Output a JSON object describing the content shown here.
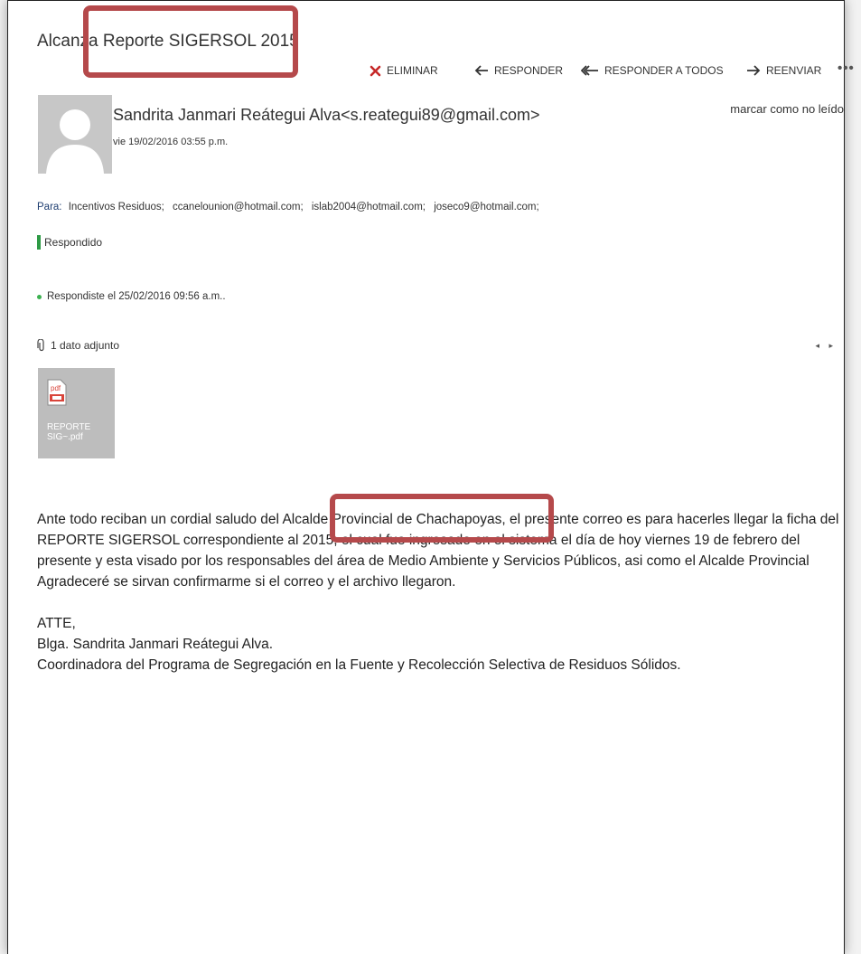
{
  "email": {
    "subject": "Alcanza Reporte SIGERSOL 2015",
    "toolbar": {
      "delete_label": "ELIMINAR",
      "reply_label": "RESPONDER",
      "reply_all_label": "RESPONDER A TODOS",
      "forward_label": "REENVIAR",
      "more_label": "•••"
    },
    "mark_unread": "marcar como no leído",
    "sender": "Sandrita Janmari Reátegui Alva<s.reategui89@gmail.com>",
    "date": "vie 19/02/2016 03:55 p.m.",
    "to_label": "Para:",
    "recipients": [
      "Incentivos Residuos;",
      "ccanelounion@hotmail.com;",
      "islab2004@hotmail.com;",
      "joseco9@hotmail.com;"
    ],
    "status": "Respondido",
    "replied_note": "Respondiste el 25/02/2016 09:56 a.m..",
    "attachment_count": "1 dato adjunto",
    "attachment_nav": "◂ ▸",
    "attachment": {
      "icon_text": "pdf",
      "file_line1": "REPORTE",
      "file_line2": "SIG~.pdf"
    },
    "body": {
      "paragraph1": "Ante todo reciban un cordial saludo del Alcalde Provincial de Chachapoyas, el presente correo es para hacerles llegar la ficha del REPORTE SIGERSOL correspondiente al 2015, el cual fue ingresado en el sistema el día de hoy viernes 19 de febrero del presente y esta visado por los responsables del área de Medio Ambiente y Servicios Públicos, asi como el Alcalde Provincial",
      "paragraph2": "Agradeceré se sirvan confirmarme si el correo y el archivo llegaron.",
      "signoff": "ATTE,",
      "sig_name": "Blga. Sandrita Janmari Reátegui Alva.",
      "sig_title": "Coordinadora del Programa de Segregación en la Fuente y Recolección Selectiva de Residuos Sólidos."
    }
  },
  "colors": {
    "highlight": "#b5494b",
    "delete_icon": "#c62828",
    "status_green": "#2e9a45",
    "avatar_bg": "#c7c7c7",
    "attachment_bg": "#bdbdbd",
    "pdf_red": "#d9443a"
  }
}
